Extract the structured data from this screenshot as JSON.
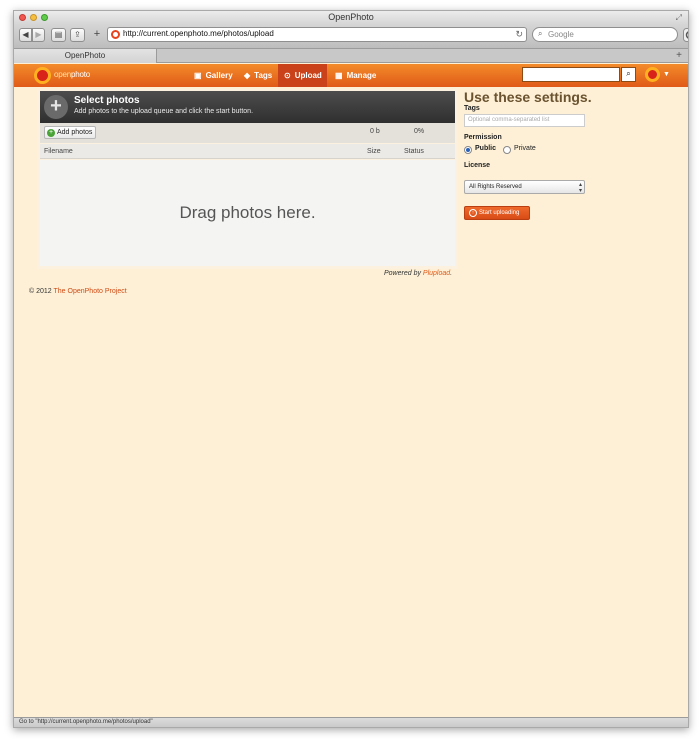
{
  "window": {
    "title": "OpenPhoto"
  },
  "toolbar": {
    "back_icon": "◀",
    "forward_icon": "▶",
    "url": "http://current.openphoto.me/photos/upload",
    "search_placeholder": "Google"
  },
  "tabs": [
    {
      "label": "OpenPhoto"
    }
  ],
  "site": {
    "logo_prefix": "open",
    "logo_suffix": "photo",
    "nav": [
      {
        "label": "Gallery",
        "icon": "image-icon"
      },
      {
        "label": "Tags",
        "icon": "tag-icon"
      },
      {
        "label": "Upload",
        "icon": "upload-icon"
      },
      {
        "label": "Manage",
        "icon": "grid-icon"
      }
    ],
    "search_value": ""
  },
  "uploader": {
    "title": "Select photos",
    "subtitle": "Add photos to the upload queue and click the start button.",
    "add_button": "Add photos",
    "total_size": "0 b",
    "total_percent": "0%",
    "columns": {
      "filename": "Filename",
      "size": "Size",
      "status": "Status"
    },
    "drop_text": "Drag photos here.",
    "powered_prefix": "Powered by ",
    "powered_link": "Plupload",
    "powered_suffix": "."
  },
  "settings": {
    "title": "Use these settings.",
    "tags_label": "Tags",
    "tags_placeholder": "Optional comma-separated list",
    "permission_label": "Permission",
    "permission_options": [
      "Public",
      "Private"
    ],
    "permission_selected": "Public",
    "license_label": "License",
    "license_value": "All Rights Reserved",
    "start_button": "Start uploading"
  },
  "footer": {
    "copyright": "© 2012 ",
    "link": "The OpenPhoto Project"
  },
  "statusbar": {
    "text": "Go to \"http://current.openphoto.me/photos/upload\""
  },
  "colors": {
    "accent": "#e05a18",
    "page_bg": "#fdf0d6",
    "nav_active": "#c9421a"
  }
}
